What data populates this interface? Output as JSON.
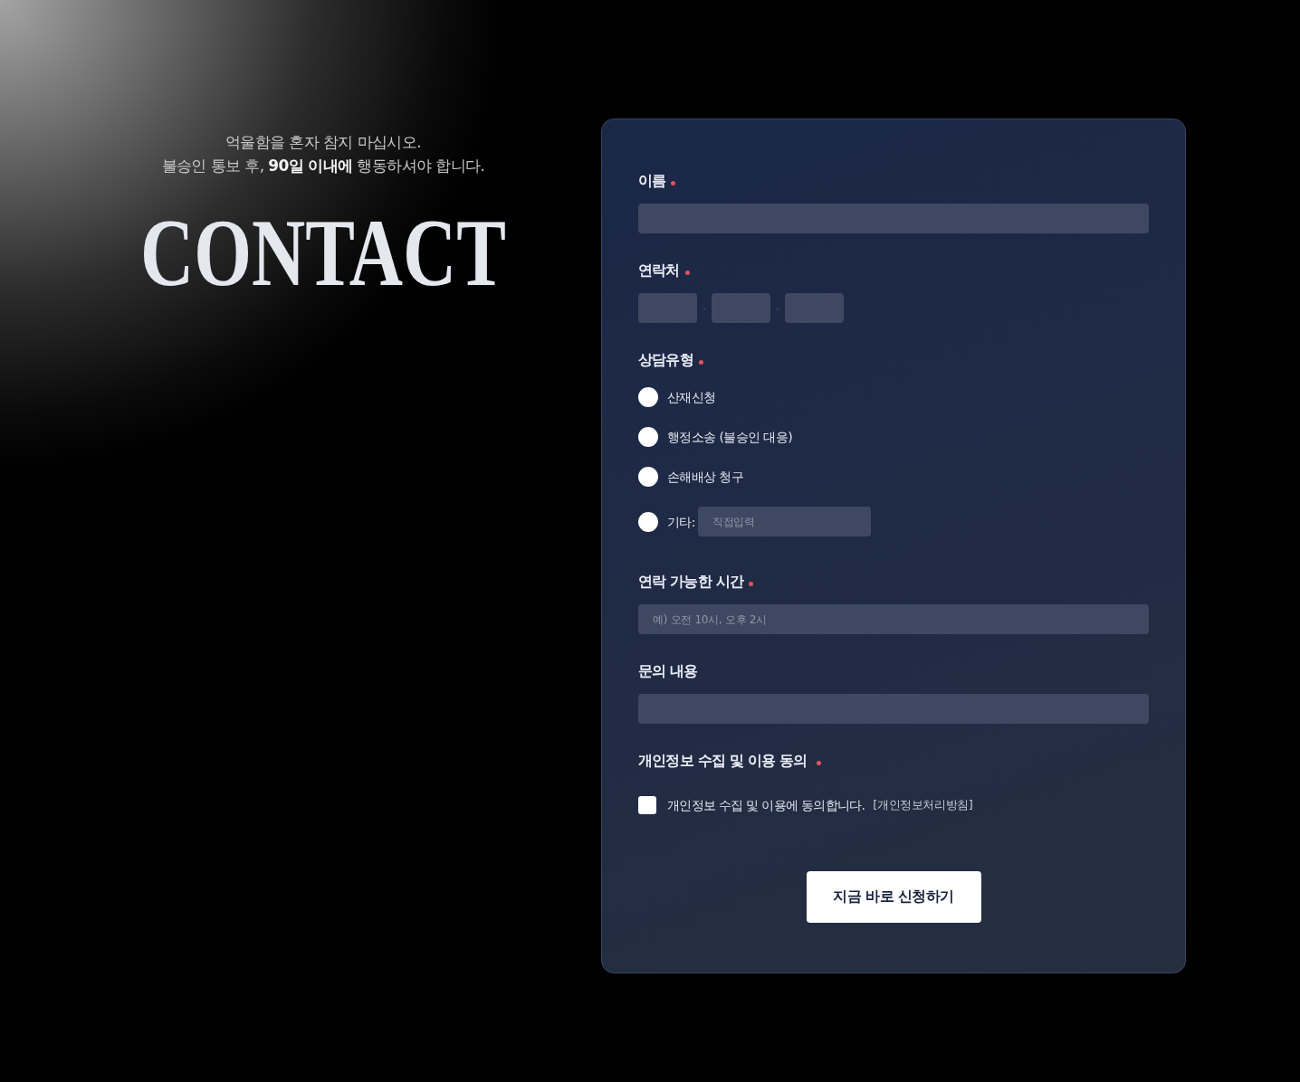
{
  "intro": {
    "lines": [
      "억울함을 혼자 참지 마십시오.",
      "불승인 통보 후, **90일 이내에** 행동하셔야 합니다."
    ]
  },
  "heading": "CONTACT",
  "form": {
    "fields": [
      {
        "kind": "text",
        "label": "이름",
        "required": true
      },
      {
        "kind": "phone",
        "label": "연락처",
        "required": true,
        "segments": [
          {
            "kind": "input"
          },
          {
            "kind": "separator",
            "text": "-"
          },
          {
            "kind": "input"
          },
          {
            "kind": "separator",
            "text": "-"
          },
          {
            "kind": "input"
          }
        ]
      },
      {
        "kind": "radio",
        "label": "상담유형",
        "required": true,
        "options": [
          {
            "kind": "plain",
            "label": "산재신청",
            "selected": false
          },
          {
            "kind": "plain",
            "label": "행정소송 (불승인 대응)",
            "selected": false
          },
          {
            "kind": "plain",
            "label": "손해배상 청구",
            "selected": false
          },
          {
            "kind": "other",
            "label": "기타:",
            "selected": false,
            "placeholder": "직접입력"
          }
        ]
      },
      {
        "kind": "text",
        "label": "연락 가능한 시간",
        "required": true,
        "placeholder": "예) 오전 10시, 오후 2시"
      },
      {
        "kind": "text",
        "label": "문의 내용",
        "required": false
      },
      {
        "kind": "consent",
        "label": "개인정보 수집 및 이용 동의",
        "required": true,
        "checkbox": {
          "checked": false,
          "text": "개인정보 수집 및 이용에 동의합니다.",
          "link": "[개인정보처리방침]"
        }
      }
    ],
    "submit": "지금 바로 신청하기"
  }
}
